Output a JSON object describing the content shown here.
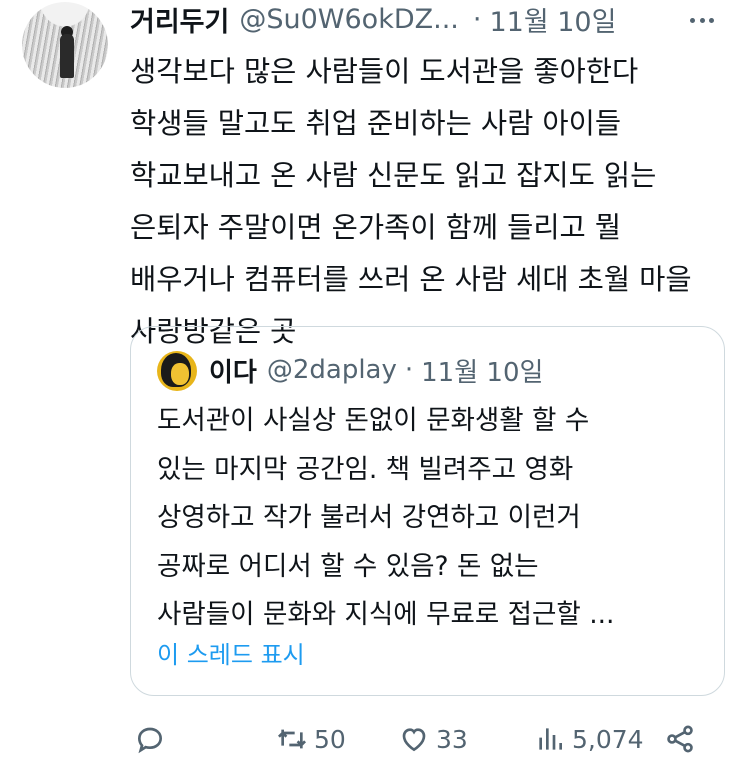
{
  "tweet": {
    "author_name": "거리두기",
    "author_handle": "@Su0W6okDZ...",
    "date": "11월 10일",
    "text_lines": [
      "생각보다 많은 사람들이 도서관을 좋아한다",
      "학생들 말고도 취업 준비하는 사람 아이들",
      "학교보내고 온 사람 신문도 읽고 잡지도 읽는",
      "은퇴자 주말이면 온가족이 함께 들리고 뭘",
      "배우거나 컴퓨터를 쓰러 온 사람 세대 초월 마을",
      "사랑방같은 곳"
    ]
  },
  "quote": {
    "author_name": "이다",
    "author_handle": "@2daplay",
    "date": "11월 10일",
    "text_lines": [
      "도서관이 사실상 돈없이 문화생활 할 수",
      "있는 마지막 공간임. 책 빌려주고 영화",
      "상영하고 작가 불러서 강연하고 이런거",
      "공짜로 어디서 할 수 있음? 돈 없는",
      "사람들이 문화와 지식에 무료로 접근할 ..."
    ],
    "show_thread": "이 스레드 표시"
  },
  "actions": {
    "reply_icon": "reply-icon",
    "retweet_count": "50",
    "like_count": "33",
    "views_count": "5,074",
    "share_icon": "share-icon"
  },
  "colors": {
    "text": "#0f1419",
    "secondary": "#536471",
    "accent": "#1d9bf0",
    "border": "#cfd9de"
  }
}
